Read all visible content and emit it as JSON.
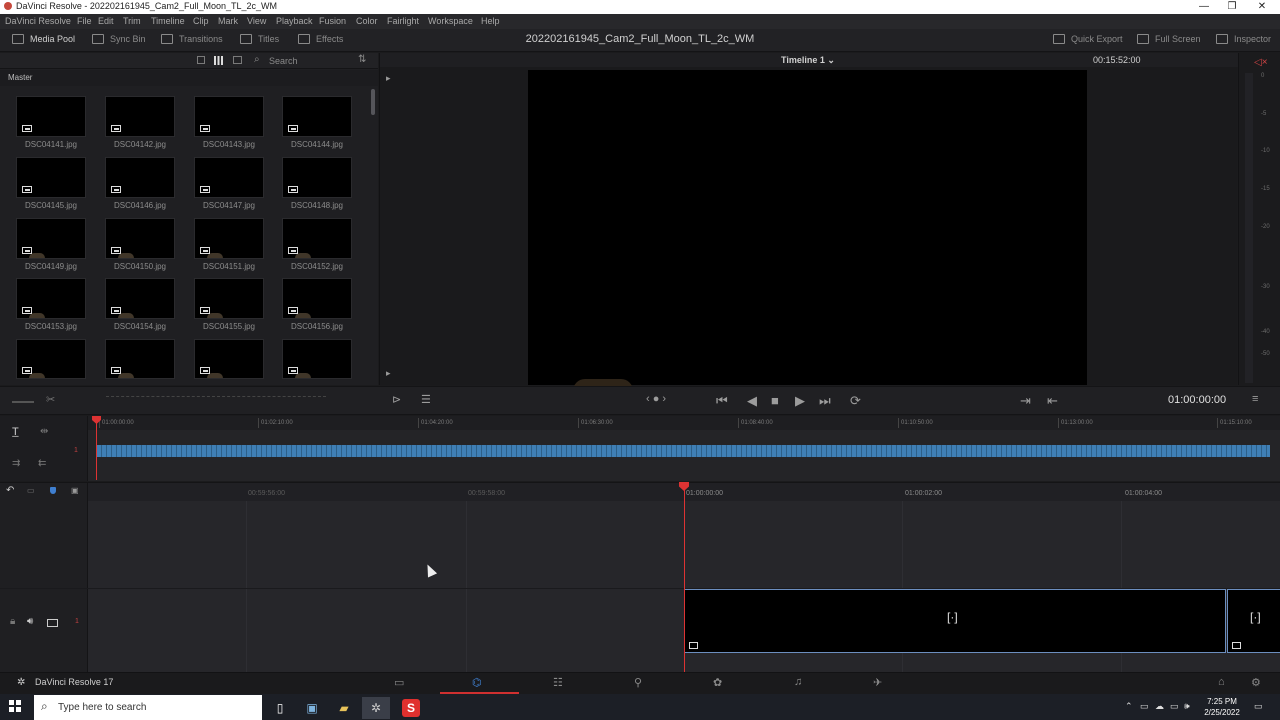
{
  "window": {
    "title": "DaVinci Resolve - 202202161945_Cam2_Full_Moon_TL_2c_WM",
    "minimize": "—",
    "maximize": "❐",
    "close": "✕"
  },
  "menu": [
    "DaVinci Resolve",
    "File",
    "Edit",
    "Trim",
    "Timeline",
    "Clip",
    "Mark",
    "View",
    "Playback",
    "Fusion",
    "Color",
    "Fairlight",
    "Workspace",
    "Help"
  ],
  "toolbar": {
    "media_pool": "Media Pool",
    "sync_bin": "Sync Bin",
    "transitions": "Transitions",
    "titles": "Titles",
    "effects": "Effects",
    "project_title": "202202161945_Cam2_Full_Moon_TL_2c_WM",
    "quick_export": "Quick Export",
    "full_screen": "Full Screen",
    "inspector": "Inspector"
  },
  "media_pool": {
    "search_placeholder": "Search",
    "bin_name": "Master",
    "clips": [
      "DSC04141.jpg",
      "DSC04142.jpg",
      "DSC04143.jpg",
      "DSC04144.jpg",
      "DSC04145.jpg",
      "DSC04146.jpg",
      "DSC04147.jpg",
      "DSC04148.jpg",
      "DSC04149.jpg",
      "DSC04150.jpg",
      "DSC04151.jpg",
      "DSC04152.jpg",
      "DSC04153.jpg",
      "DSC04154.jpg",
      "DSC04155.jpg",
      "DSC04156.jpg"
    ]
  },
  "viewer": {
    "timeline_name": "Timeline 1 ⌄",
    "duration": "00:15:52:00",
    "timecode": "01:00:00:00",
    "meter_labels": [
      "0",
      "-5",
      "-10",
      "-15",
      "-20",
      "-30",
      "-40",
      "-50"
    ]
  },
  "upper_timeline": {
    "ruler": [
      "01:00:00:00",
      "01:02:10:00",
      "01:04:20:00",
      "01:06:30:00",
      "01:08:40:00",
      "01:10:50:00",
      "01:13:00:00",
      "01:15:10:00"
    ],
    "track_number": "1"
  },
  "lower_timeline": {
    "ruler": [
      "00:59:56:00",
      "00:59:58:00",
      "01:00:00:00",
      "01:00:02:00",
      "01:00:04:00"
    ],
    "track_number": "1"
  },
  "pagebar": {
    "app_name": "DaVinci Resolve 17"
  },
  "taskbar": {
    "search_placeholder": "Type here to search",
    "time": "7:25 PM",
    "date": "2/25/2022"
  },
  "colors": {
    "accent_red": "#d33333",
    "clip_border": "#6c8ebf",
    "audio_blue": "#3f7fb5"
  }
}
